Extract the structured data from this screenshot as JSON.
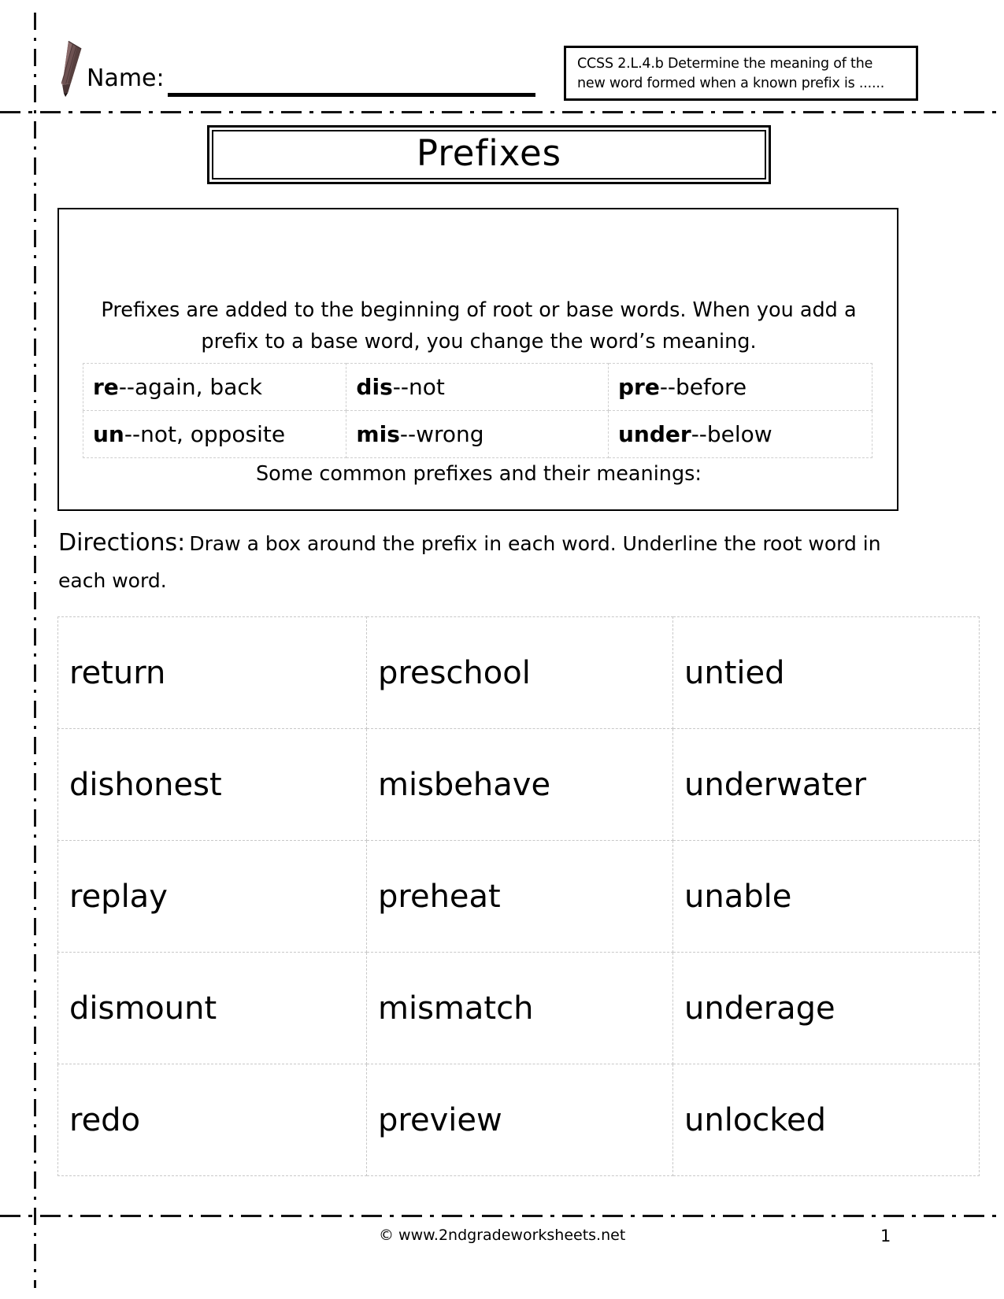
{
  "header": {
    "pencil_icon": "pencil-icon",
    "name_label": "Name:",
    "ccss_line1": "CCSS 2.L.4.b Determine the meaning of the",
    "ccss_line2": "new word formed when a known prefix is ......"
  },
  "title": "Prefixes",
  "info": {
    "intro_line1": "Prefixes are added to the beginning of root or base words.  When you add a",
    "intro_line2": "prefix to a base word, you change the word’s meaning.",
    "caption": "Some common prefixes and their meanings:",
    "prefix_rows": [
      [
        {
          "prefix": "re",
          "meaning": "--again, back"
        },
        {
          "prefix": "dis",
          "meaning": "--not"
        },
        {
          "prefix": "pre",
          "meaning": "--before"
        }
      ],
      [
        {
          "prefix": "un",
          "meaning": "--not, opposite"
        },
        {
          "prefix": "mis",
          "meaning": "--wrong"
        },
        {
          "prefix": "under",
          "meaning": "--below"
        }
      ]
    ]
  },
  "directions": {
    "label": "Directions:",
    "body": "Draw a box around the prefix in each word.  Underline the root word in each word."
  },
  "word_grid": {
    "rows": [
      [
        "return",
        "preschool",
        "untied"
      ],
      [
        "dishonest",
        "misbehave",
        "underwater"
      ],
      [
        "replay",
        "preheat",
        "unable"
      ],
      [
        "dismount",
        "mismatch",
        "underage"
      ],
      [
        "redo",
        "preview",
        "unlocked"
      ]
    ]
  },
  "footer": {
    "credit": "© www.2ndgradeworksheets.net",
    "page_number": "1"
  },
  "colors": {
    "ink": "#000000",
    "pencil_body": "#6e5252",
    "pencil_shadow": "#4a3636",
    "grid_line": "#c8c8c8",
    "paper": "#ffffff"
  }
}
